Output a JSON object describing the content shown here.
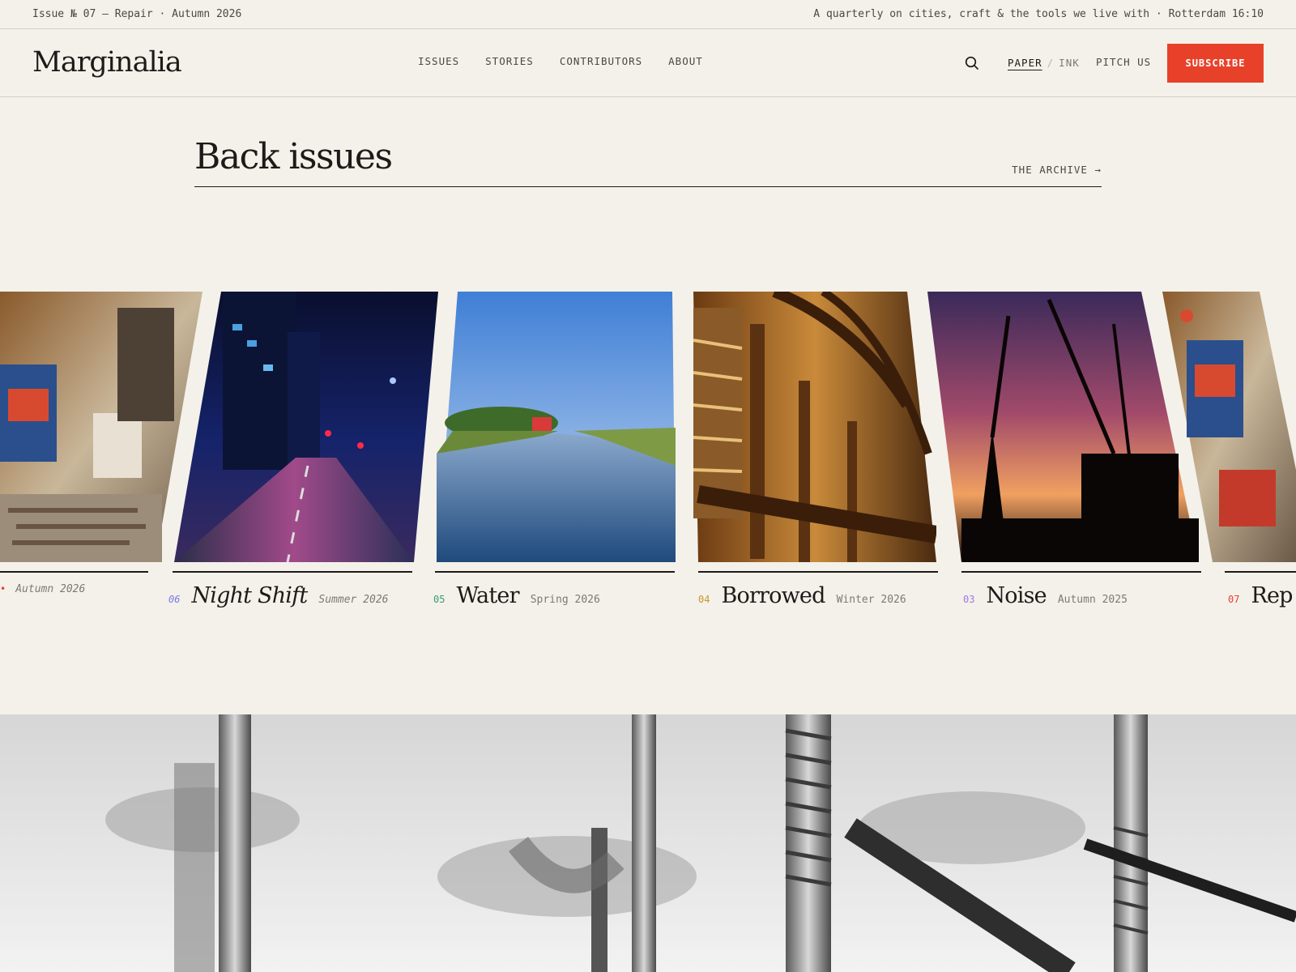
{
  "topstrip": {
    "issue_line": "Issue № 07 — Repair · Autumn 2026",
    "tagline": "A quarterly on cities, craft & the tools we live with · Rotterdam 16:10"
  },
  "header": {
    "logo": "Marginalia",
    "nav": [
      "ISSUES",
      "STORIES",
      "CONTRIBUTORS",
      "ABOUT"
    ],
    "search_icon": "search-icon",
    "theme": {
      "paper": "PAPER",
      "sep": "/",
      "ink": "INK",
      "active": "paper"
    },
    "pitch": "PITCH US",
    "subscribe": "SUBSCRIBE"
  },
  "section": {
    "title": "Back issues",
    "archive_link": "THE ARCHIVE →"
  },
  "issues": [
    {
      "number": "",
      "title": "",
      "season": "Autumn 2026",
      "accent": "#e8412a",
      "image": "workshop-tools-photo"
    },
    {
      "number": "06",
      "title": "Night Shift",
      "season": "Summer 2026",
      "accent": "#7b78e6",
      "image": "night-street-photo"
    },
    {
      "number": "05",
      "title": "Water",
      "season": "Spring 2026",
      "accent": "#3c9a7a",
      "image": "canal-landscape-photo"
    },
    {
      "number": "04",
      "title": "Borrowed",
      "season": "Winter 2026",
      "accent": "#c8962e",
      "image": "library-interior-photo"
    },
    {
      "number": "03",
      "title": "Noise",
      "season": "Autumn 2025",
      "accent": "#9b7be6",
      "image": "cranes-sunset-photo"
    },
    {
      "number": "07",
      "title": "Rep",
      "season": "",
      "accent": "#e8412a",
      "image": "workshop-tools-photo"
    }
  ],
  "hero": {
    "image": "screws-closeup-photo"
  },
  "colors": {
    "background": "#f4f1ea",
    "ink": "#1c1b19",
    "accent": "#e8412a",
    "muted": "#7d7a72"
  }
}
